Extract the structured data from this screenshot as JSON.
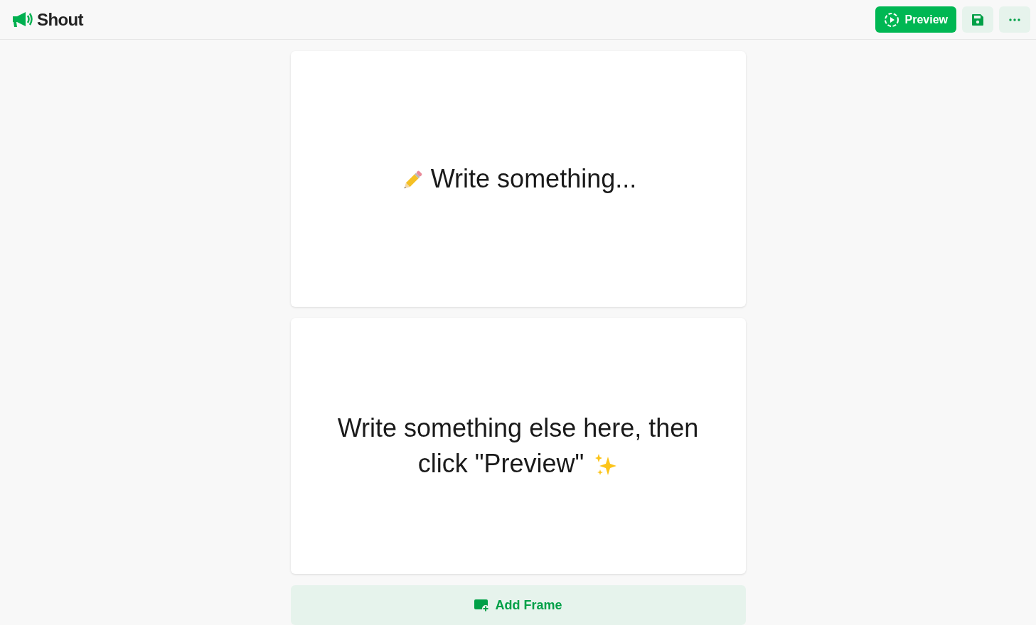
{
  "header": {
    "brand": "Shout",
    "preview_button": "Preview"
  },
  "frames": [
    {
      "kind": "pencil",
      "text": "Write something..."
    },
    {
      "kind": "sparkles",
      "text": "Write something else here, then click \"Preview\""
    }
  ],
  "add_frame_button": "Add Frame"
}
